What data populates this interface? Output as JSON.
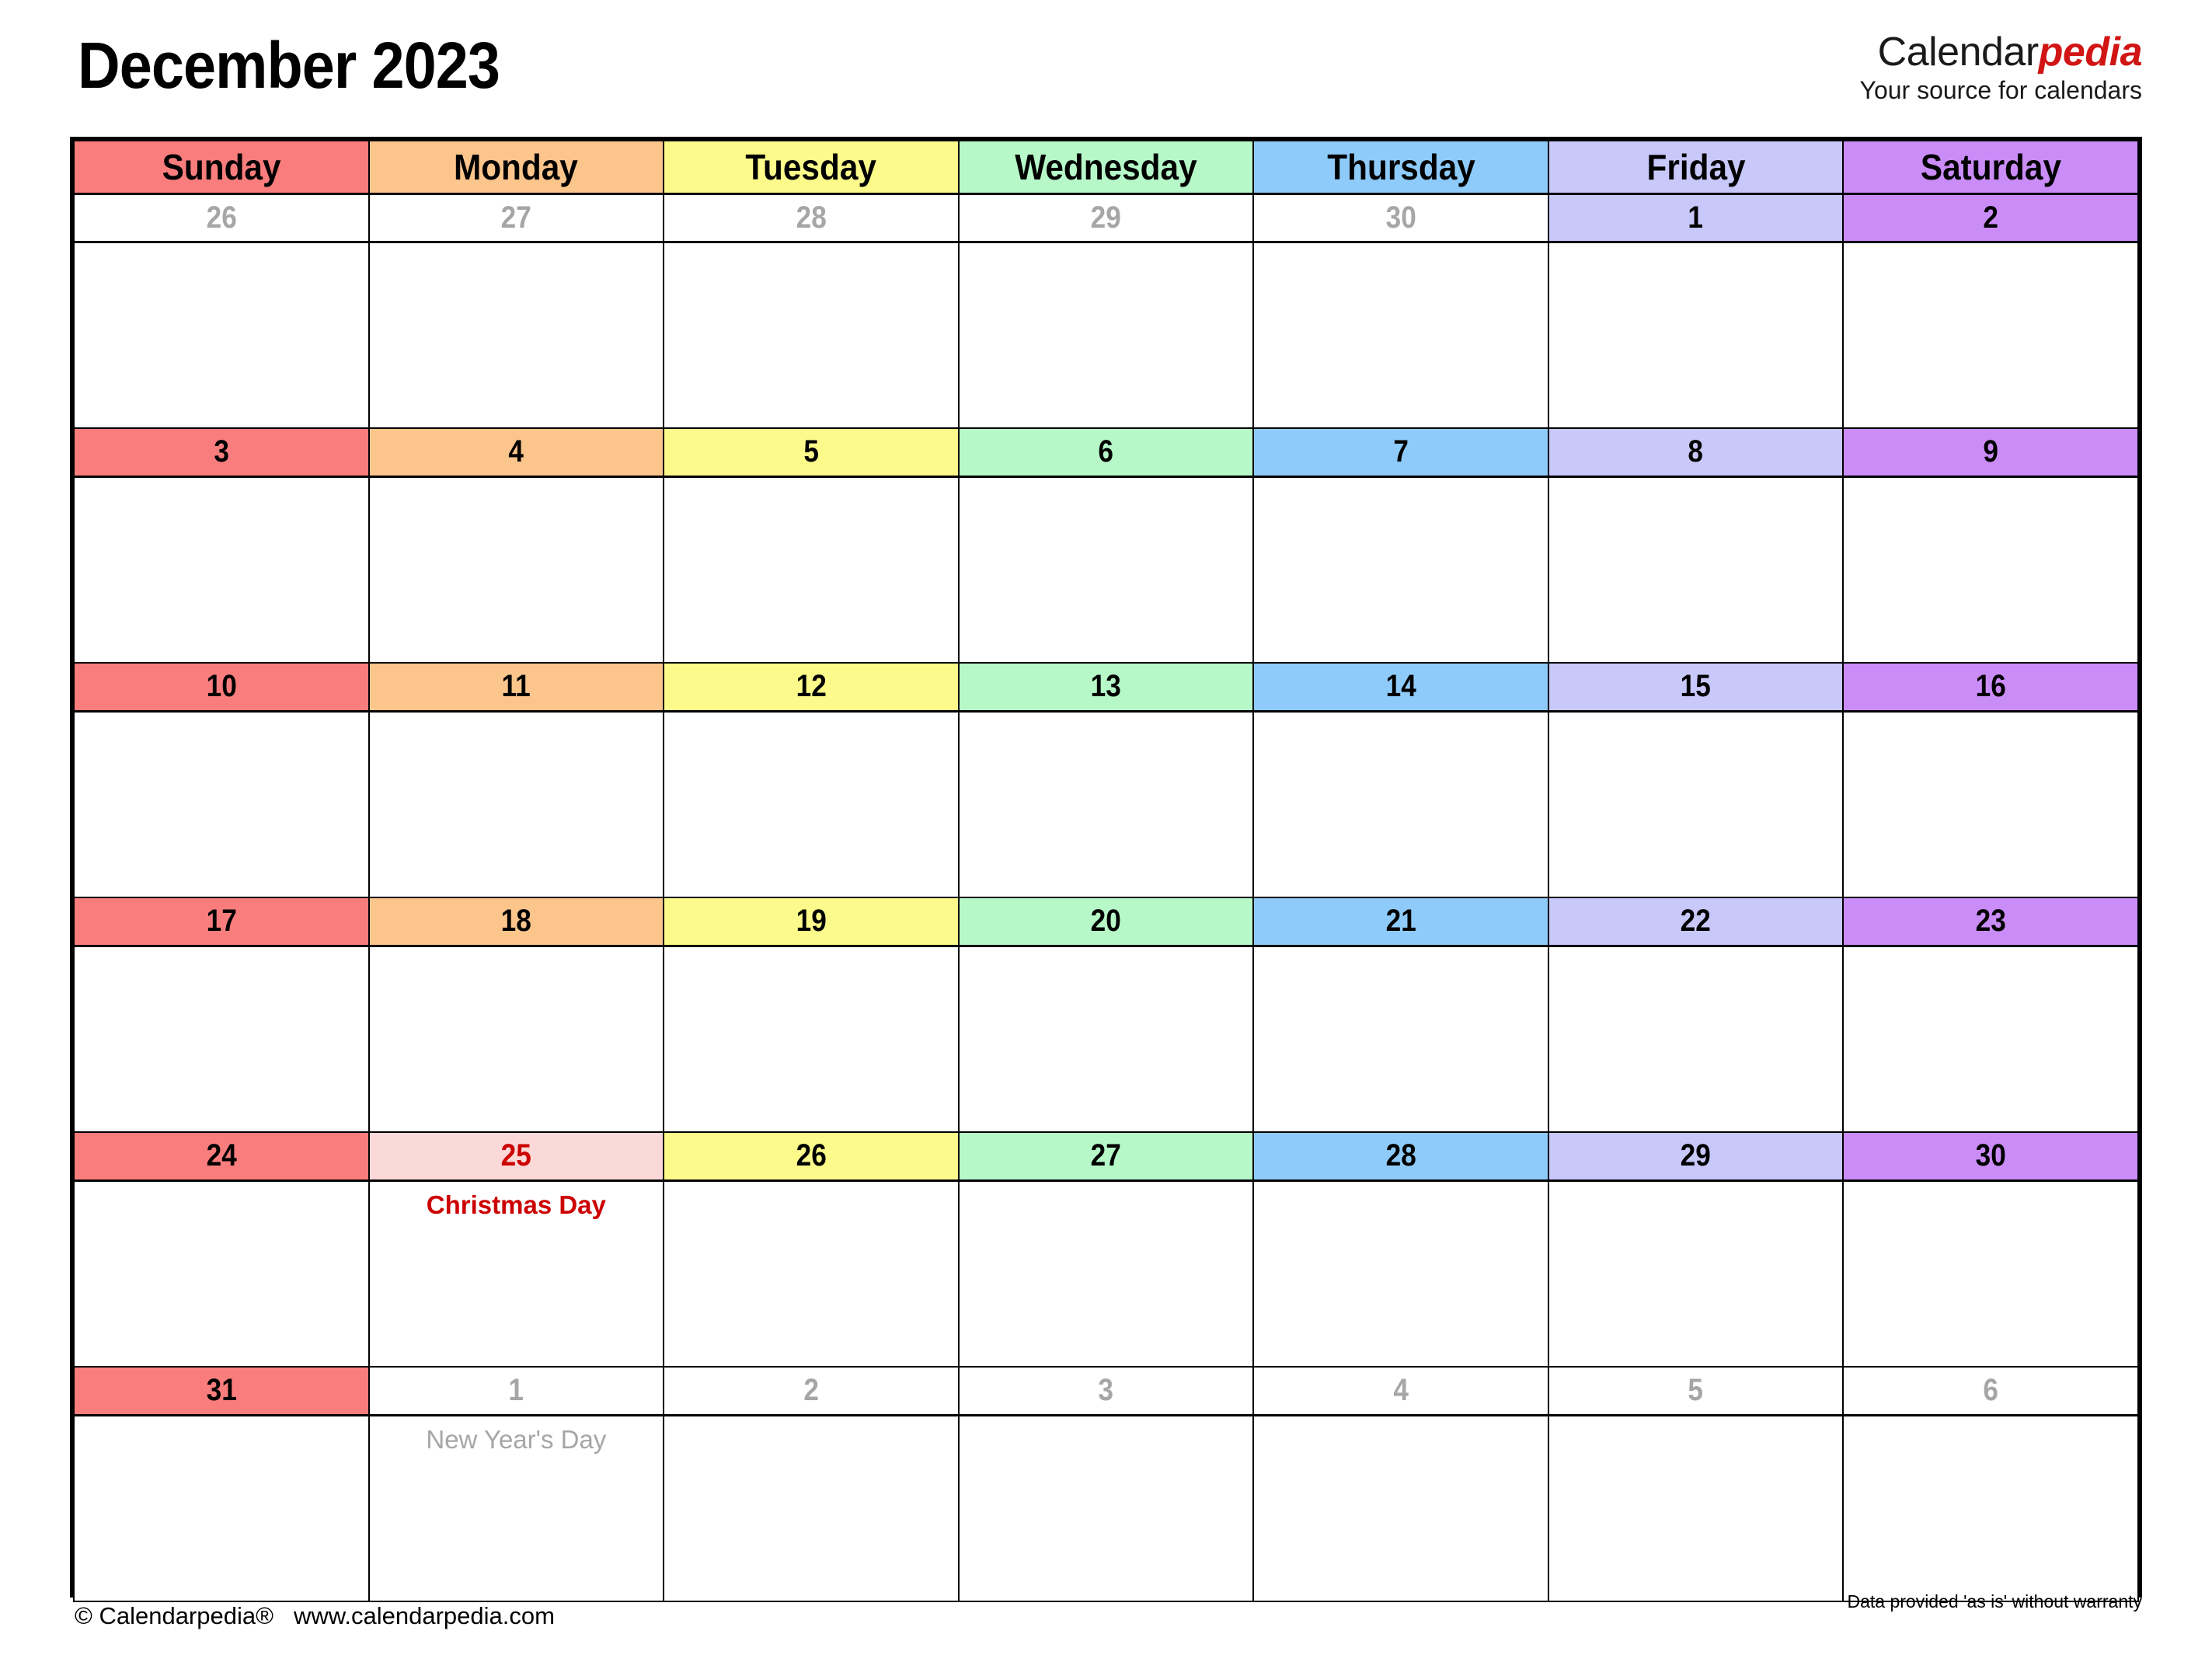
{
  "title": "December 2023",
  "brand": {
    "name_plain": "Calendar",
    "name_accent": "pedia",
    "tagline": "Your source for calendars",
    "accent_color": "#d11414"
  },
  "weekdays": [
    {
      "label": "Sunday",
      "color": "#fa7d7d"
    },
    {
      "label": "Monday",
      "color": "#fcc58c"
    },
    {
      "label": "Tuesday",
      "color": "#fbfa8a"
    },
    {
      "label": "Wednesday",
      "color": "#b6f8c8"
    },
    {
      "label": "Thursday",
      "color": "#8ecbfa"
    },
    {
      "label": "Friday",
      "color": "#c8c8fb"
    },
    {
      "label": "Saturday",
      "color": "#ca8cf7"
    }
  ],
  "weeks": [
    {
      "days": [
        {
          "num": "26",
          "in_month": false,
          "note": ""
        },
        {
          "num": "27",
          "in_month": false,
          "note": ""
        },
        {
          "num": "28",
          "in_month": false,
          "note": ""
        },
        {
          "num": "29",
          "in_month": false,
          "note": ""
        },
        {
          "num": "30",
          "in_month": false,
          "note": ""
        },
        {
          "num": "1",
          "in_month": true,
          "note": ""
        },
        {
          "num": "2",
          "in_month": true,
          "note": ""
        }
      ]
    },
    {
      "days": [
        {
          "num": "3",
          "in_month": true,
          "note": ""
        },
        {
          "num": "4",
          "in_month": true,
          "note": ""
        },
        {
          "num": "5",
          "in_month": true,
          "note": ""
        },
        {
          "num": "6",
          "in_month": true,
          "note": ""
        },
        {
          "num": "7",
          "in_month": true,
          "note": ""
        },
        {
          "num": "8",
          "in_month": true,
          "note": ""
        },
        {
          "num": "9",
          "in_month": true,
          "note": ""
        }
      ]
    },
    {
      "days": [
        {
          "num": "10",
          "in_month": true,
          "note": ""
        },
        {
          "num": "11",
          "in_month": true,
          "note": ""
        },
        {
          "num": "12",
          "in_month": true,
          "note": ""
        },
        {
          "num": "13",
          "in_month": true,
          "note": ""
        },
        {
          "num": "14",
          "in_month": true,
          "note": ""
        },
        {
          "num": "15",
          "in_month": true,
          "note": ""
        },
        {
          "num": "16",
          "in_month": true,
          "note": ""
        }
      ]
    },
    {
      "days": [
        {
          "num": "17",
          "in_month": true,
          "note": ""
        },
        {
          "num": "18",
          "in_month": true,
          "note": ""
        },
        {
          "num": "19",
          "in_month": true,
          "note": ""
        },
        {
          "num": "20",
          "in_month": true,
          "note": ""
        },
        {
          "num": "21",
          "in_month": true,
          "note": ""
        },
        {
          "num": "22",
          "in_month": true,
          "note": ""
        },
        {
          "num": "23",
          "in_month": true,
          "note": ""
        }
      ]
    },
    {
      "days": [
        {
          "num": "24",
          "in_month": true,
          "note": ""
        },
        {
          "num": "25",
          "in_month": true,
          "note": "Christmas Day",
          "holiday": true
        },
        {
          "num": "26",
          "in_month": true,
          "note": ""
        },
        {
          "num": "27",
          "in_month": true,
          "note": ""
        },
        {
          "num": "28",
          "in_month": true,
          "note": ""
        },
        {
          "num": "29",
          "in_month": true,
          "note": ""
        },
        {
          "num": "30",
          "in_month": true,
          "note": ""
        }
      ]
    },
    {
      "days": [
        {
          "num": "31",
          "in_month": true,
          "note": ""
        },
        {
          "num": "1",
          "in_month": false,
          "note": "New Year's Day"
        },
        {
          "num": "2",
          "in_month": false,
          "note": ""
        },
        {
          "num": "3",
          "in_month": false,
          "note": ""
        },
        {
          "num": "4",
          "in_month": false,
          "note": ""
        },
        {
          "num": "5",
          "in_month": false,
          "note": ""
        },
        {
          "num": "6",
          "in_month": false,
          "note": ""
        }
      ]
    }
  ],
  "footer": {
    "copyright": "© Calendarpedia®",
    "website": "www.calendarpedia.com",
    "disclaimer": "Data provided 'as is' without warranty"
  }
}
